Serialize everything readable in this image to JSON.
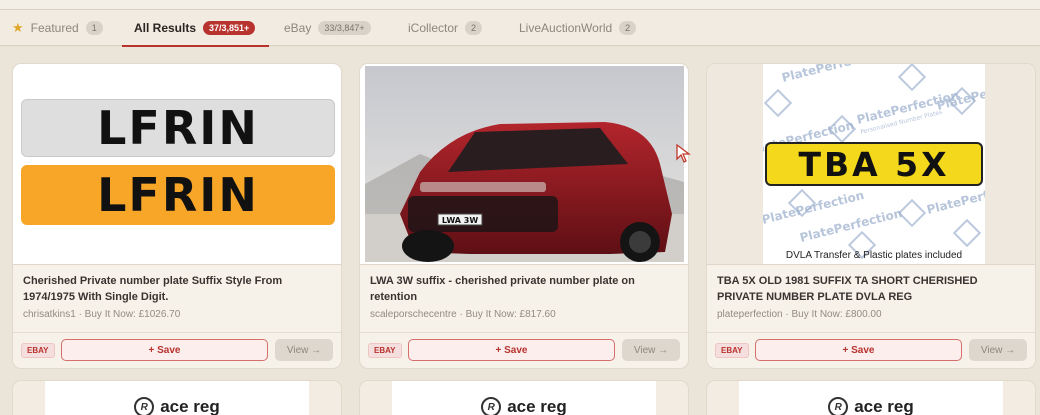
{
  "tabs": [
    {
      "label": "Featured",
      "count": "1",
      "icon": "star-icon"
    },
    {
      "label": "All Results",
      "count": "37/3,851+"
    },
    {
      "label": "eBay",
      "count": "33/3,847+"
    },
    {
      "label": "iCollector",
      "count": "2"
    },
    {
      "label": "LiveAuctionWorld",
      "count": "2"
    }
  ],
  "cards": [
    {
      "plates": [
        "LFRIN",
        "LFRIN"
      ],
      "title": "Cherished Private number plate Suffix Style From 1974/1975 With Single Digit.",
      "meta": "chrisatkins1 · Buy It Now: £1026.70",
      "badge": "EBAY",
      "save": "+ Save",
      "view": "View →"
    },
    {
      "plate": "LWA 3W",
      "title": "LWA 3W suffix - cherished private number plate on retention",
      "meta": "scaleporschecentre · Buy It Now: £817.60",
      "badge": "EBAY",
      "save": "+ Save",
      "view": "View →"
    },
    {
      "plate": "TBA 5X",
      "watermark": "PlatePerfection",
      "watermark_sub": "Personalised Number Plates",
      "caption": "DVLA Transfer & Plastic plates included",
      "title": "TBA 5X OLD 1981 SUFFIX TA SHORT CHERISHED PRIVATE NUMBER PLATE DVLA REG",
      "meta": "plateperfection · Buy It Now: £800.00",
      "badge": "EBAY",
      "save": "+ Save",
      "view": "View →"
    }
  ],
  "row2_logo": "ace reg",
  "row2_mark": "R"
}
